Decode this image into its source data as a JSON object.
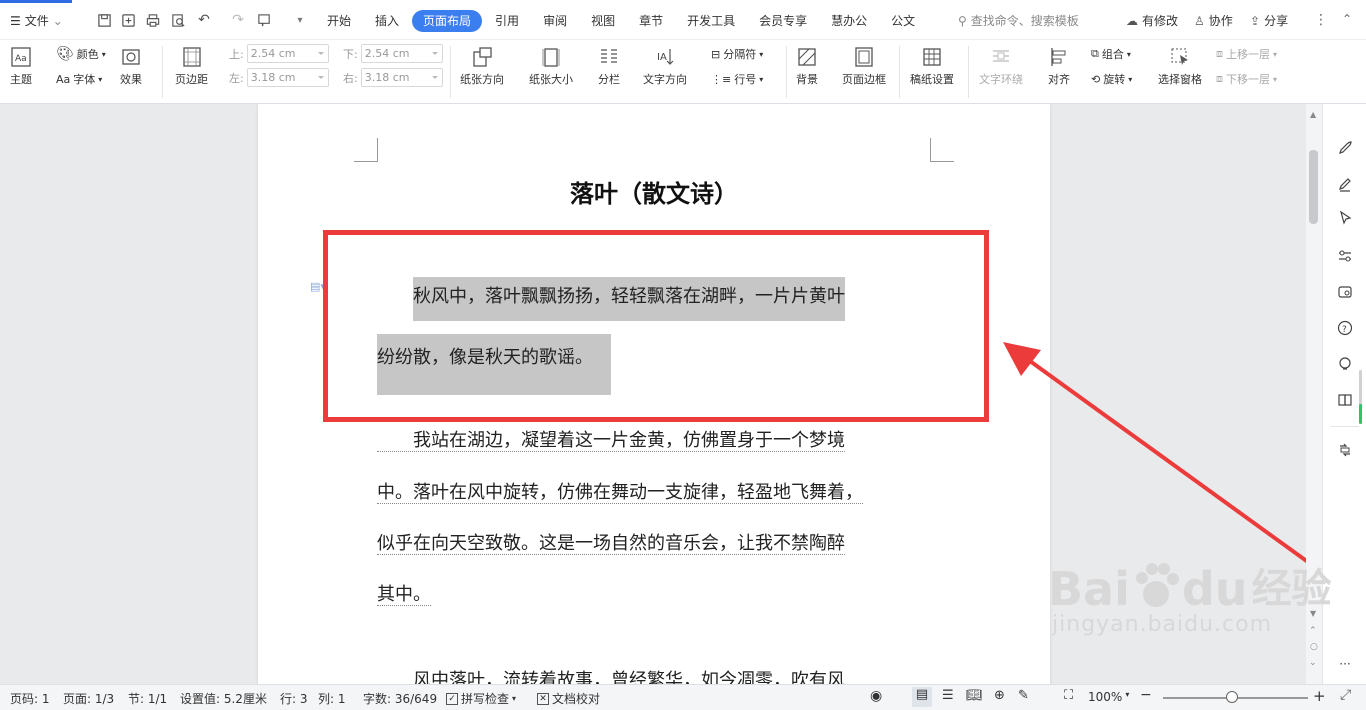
{
  "titlebar": {
    "file_label": "文件",
    "tabs": [
      {
        "label": "开始"
      },
      {
        "label": "插入"
      },
      {
        "label": "页面布局"
      },
      {
        "label": "引用"
      },
      {
        "label": "审阅"
      },
      {
        "label": "视图"
      },
      {
        "label": "章节"
      },
      {
        "label": "开发工具"
      },
      {
        "label": "会员专享"
      },
      {
        "label": "慧办公"
      },
      {
        "label": "公文"
      }
    ],
    "active_tab": "页面布局",
    "search_placeholder": "查找命令、搜索模板",
    "has_changes": "有修改",
    "collaborate": "协作",
    "share": "分享"
  },
  "ribbon": {
    "theme": "主题",
    "color": "颜色",
    "font": "字体",
    "font_prefix": "Aa",
    "effect": "效果",
    "margins": "页边距",
    "margin_top_label": "上:",
    "margin_top": "2.54 cm",
    "margin_bottom_label": "下:",
    "margin_bottom": "2.54 cm",
    "margin_left_label": "左:",
    "margin_left": "3.18 cm",
    "margin_right_label": "右:",
    "margin_right": "3.18 cm",
    "orientation": "纸张方向",
    "size": "纸张大小",
    "columns": "分栏",
    "text_direction": "文字方向",
    "breaks": "分隔符",
    "line_numbers": "行号",
    "background": "背景",
    "page_border": "页面边框",
    "manuscript": "稿纸设置",
    "text_wrap": "文字环绕",
    "align": "对齐",
    "group": "组合",
    "rotate": "旋转",
    "selection_pane": "选择窗格",
    "bring_forward": "上移一层",
    "send_backward": "下移一层"
  },
  "document": {
    "title": "落叶（散文诗）",
    "p1_line1_indent": "　　",
    "p1_line1": "秋风中，落叶飘飘扬扬，轻轻飘落在湖畔，一片片黄叶",
    "p1_line2": "纷纷散，像是秋天的歌谣。",
    "p2_line1": "　　我站在湖边，凝望着这一片金黄，仿佛置身于一个梦境",
    "p2_line2": "中。落叶在风中旋转，仿佛在舞动一支旋律，轻盈地飞舞着，",
    "p2_line3": "似乎在向天空致敬。这是一场自然的音乐会，让我不禁陶醉",
    "p2_line4": "其中。",
    "p3_line1": "　　风中落叶，流转着故事，曾经繁华，如今凋零，吹有风"
  },
  "statusbar": {
    "page_num": "页码: 1",
    "pages": "页面: 1/3",
    "section": "节: 1/1",
    "setting": "设置值: 5.2厘米",
    "row": "行: 3",
    "col": "列: 1",
    "word_count": "字数: 36/649",
    "spell_check": "拼写检查",
    "proofread": "文档校对",
    "zoom": "100%"
  },
  "watermark": {
    "brand": "Bai",
    "brand2": "du",
    "brand_cn": "经验",
    "url": "jingyan.baidu.com"
  },
  "colors": {
    "accent": "#3b7ef0",
    "selection": "#c6c6c6",
    "annotation": "#ec3b3b"
  }
}
